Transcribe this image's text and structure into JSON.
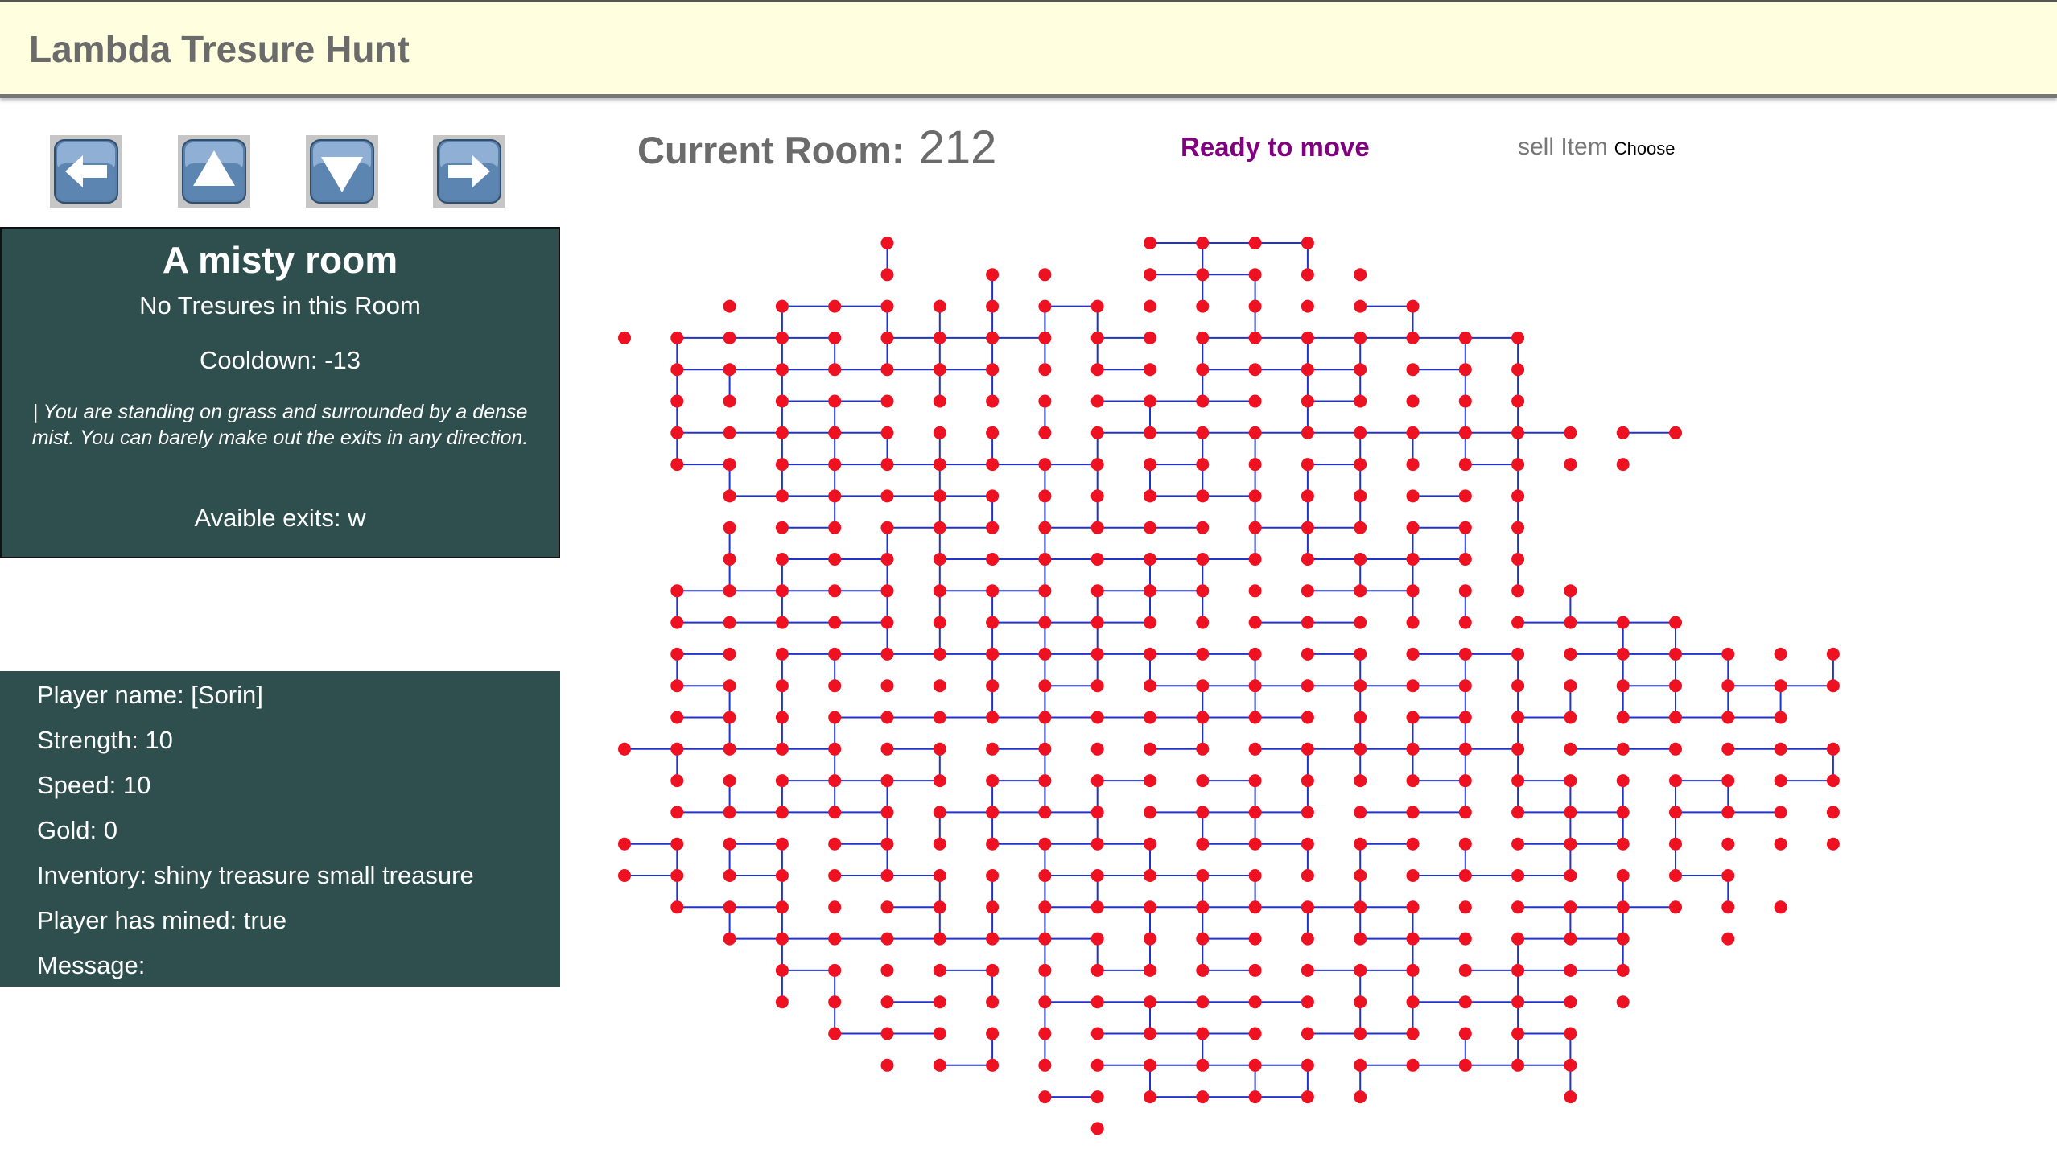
{
  "app": {
    "title": "Lambda Tresure Hunt"
  },
  "controls": [
    {
      "name": "west-button",
      "icon": "arrow-left-icon",
      "dir": "w"
    },
    {
      "name": "north-button",
      "icon": "arrow-up-icon",
      "dir": "n"
    },
    {
      "name": "south-button",
      "icon": "arrow-down-icon",
      "dir": "s"
    },
    {
      "name": "east-button",
      "icon": "arrow-right-icon",
      "dir": "e"
    }
  ],
  "room": {
    "title": "A misty room",
    "treasure": "No Tresures in this Room",
    "cooldown": "Cooldown: -13",
    "description": "| You are standing on grass and surrounded by a dense mist. You can barely make out the exits in any direction.",
    "exits": "Avaible exits: w"
  },
  "player": {
    "name": "Player name: [Sorin]",
    "strength": "Strength: 10",
    "speed": "Speed: 10",
    "gold": "Gold: 0",
    "inventory": "Inventory: shiny treasure small treasure",
    "mined": "Player has mined: true",
    "message": "Message:"
  },
  "status_bar": {
    "current_room_label": "Current Room:",
    "current_room_value": "212",
    "status": "Ready to move",
    "sell_label": "sell Item",
    "sell_choose": "Choose"
  },
  "map": {
    "node_color": "#ee1122",
    "edge_color": "#2233cc",
    "current_color": "#000000",
    "current_room": "28,14",
    "rows": [
      {
        "y": 0,
        "xs": [
          5,
          10,
          11,
          12,
          13
        ]
      },
      {
        "y": 1,
        "xs": [
          5,
          7,
          8,
          10,
          11,
          12,
          13,
          14
        ]
      },
      {
        "y": 2,
        "xs": [
          2,
          3,
          4,
          5,
          6,
          7,
          8,
          9,
          10,
          11,
          12,
          13,
          14,
          15
        ]
      },
      {
        "y": 3,
        "xs": [
          0,
          1,
          2,
          3,
          4,
          5,
          6,
          7,
          8,
          9,
          10,
          11,
          12,
          13,
          14,
          15,
          16,
          17
        ]
      },
      {
        "y": 4,
        "xs": [
          1,
          2,
          3,
          4,
          5,
          6,
          7,
          8,
          9,
          10,
          11,
          12,
          13,
          14,
          15,
          16,
          17
        ]
      },
      {
        "y": 5,
        "xs": [
          1,
          2,
          3,
          4,
          5,
          6,
          7,
          8,
          9,
          10,
          11,
          12,
          13,
          14,
          15,
          16,
          17
        ]
      },
      {
        "y": 6,
        "xs": [
          1,
          2,
          3,
          4,
          5,
          6,
          7,
          8,
          9,
          10,
          11,
          12,
          13,
          14,
          15,
          16,
          17,
          18,
          19,
          20
        ]
      },
      {
        "y": 7,
        "xs": [
          1,
          2,
          3,
          4,
          5,
          6,
          7,
          8,
          9,
          10,
          11,
          12,
          13,
          14,
          15,
          16,
          17,
          18,
          19
        ]
      },
      {
        "y": 8,
        "xs": [
          2,
          3,
          4,
          5,
          6,
          7,
          8,
          9,
          10,
          11,
          12,
          13,
          14,
          15,
          16,
          17
        ]
      },
      {
        "y": 9,
        "xs": [
          2,
          3,
          4,
          5,
          6,
          7,
          8,
          9,
          10,
          11,
          12,
          13,
          14,
          15,
          16,
          17
        ]
      },
      {
        "y": 10,
        "xs": [
          2,
          3,
          4,
          5,
          6,
          7,
          8,
          9,
          10,
          11,
          12,
          13,
          14,
          15,
          16,
          17
        ]
      },
      {
        "y": 11,
        "xs": [
          1,
          2,
          3,
          4,
          5,
          6,
          7,
          8,
          9,
          10,
          11,
          12,
          13,
          14,
          15,
          16,
          17,
          18
        ]
      },
      {
        "y": 12,
        "xs": [
          1,
          2,
          3,
          4,
          5,
          6,
          7,
          8,
          9,
          10,
          11,
          12,
          13,
          14,
          15,
          16,
          17,
          18,
          19,
          20
        ]
      },
      {
        "y": 13,
        "xs": [
          1,
          2,
          3,
          4,
          5,
          6,
          7,
          8,
          9,
          10,
          11,
          12,
          13,
          14,
          15,
          16,
          17,
          18,
          19,
          20,
          21,
          22,
          23
        ]
      },
      {
        "y": 14,
        "xs": [
          1,
          2,
          3,
          4,
          5,
          6,
          7,
          8,
          9,
          10,
          11,
          12,
          13,
          14,
          15,
          16,
          17,
          18,
          19,
          20,
          21,
          22,
          23
        ]
      },
      {
        "y": 15,
        "xs": [
          1,
          2,
          3,
          4,
          5,
          6,
          7,
          8,
          9,
          10,
          11,
          12,
          13,
          14,
          15,
          16,
          17,
          18,
          19,
          20,
          21,
          22
        ]
      },
      {
        "y": 16,
        "xs": [
          0,
          1,
          2,
          3,
          4,
          5,
          6,
          7,
          8,
          9,
          10,
          11,
          12,
          13,
          14,
          15,
          16,
          17,
          18,
          19,
          20,
          21,
          22,
          23
        ]
      },
      {
        "y": 17,
        "xs": [
          1,
          2,
          3,
          4,
          5,
          6,
          7,
          8,
          9,
          10,
          11,
          12,
          13,
          14,
          15,
          16,
          17,
          18,
          19,
          20,
          21,
          22,
          23
        ]
      },
      {
        "y": 18,
        "xs": [
          1,
          2,
          3,
          4,
          5,
          6,
          7,
          8,
          9,
          10,
          11,
          12,
          13,
          14,
          15,
          16,
          17,
          18,
          19,
          20,
          21,
          22,
          23
        ]
      },
      {
        "y": 19,
        "xs": [
          0,
          1,
          2,
          3,
          4,
          5,
          6,
          7,
          8,
          9,
          10,
          11,
          12,
          13,
          14,
          15,
          16,
          17,
          18,
          19,
          20,
          21,
          22,
          23
        ]
      },
      {
        "y": 20,
        "xs": [
          0,
          1,
          2,
          3,
          4,
          5,
          6,
          7,
          8,
          9,
          10,
          11,
          12,
          13,
          14,
          15,
          16,
          17,
          18,
          19,
          20,
          21
        ]
      },
      {
        "y": 21,
        "xs": [
          1,
          2,
          3,
          4,
          5,
          6,
          7,
          8,
          9,
          10,
          11,
          12,
          13,
          14,
          15,
          16,
          17,
          18,
          19,
          20,
          21,
          22
        ]
      },
      {
        "y": 22,
        "xs": [
          2,
          3,
          4,
          5,
          6,
          7,
          8,
          9,
          10,
          11,
          12,
          13,
          14,
          15,
          16,
          17,
          18,
          19,
          21
        ]
      },
      {
        "y": 23,
        "xs": [
          3,
          4,
          5,
          6,
          7,
          8,
          9,
          10,
          11,
          12,
          13,
          14,
          15,
          16,
          17,
          18,
          19
        ]
      },
      {
        "y": 24,
        "xs": [
          3,
          4,
          5,
          6,
          7,
          8,
          9,
          10,
          11,
          12,
          13,
          14,
          15,
          16,
          17,
          18,
          19
        ]
      },
      {
        "y": 25,
        "xs": [
          4,
          5,
          6,
          7,
          8,
          9,
          10,
          11,
          12,
          13,
          14,
          15,
          16,
          17,
          18
        ]
      },
      {
        "y": 26,
        "xs": [
          5,
          6,
          7,
          8,
          9,
          10,
          11,
          12,
          13,
          14,
          15,
          16,
          17,
          18
        ]
      },
      {
        "y": 27,
        "xs": [
          8,
          9,
          10,
          11,
          12,
          13,
          14,
          18
        ]
      },
      {
        "y": 28,
        "xs": [
          9
        ]
      }
    ]
  }
}
